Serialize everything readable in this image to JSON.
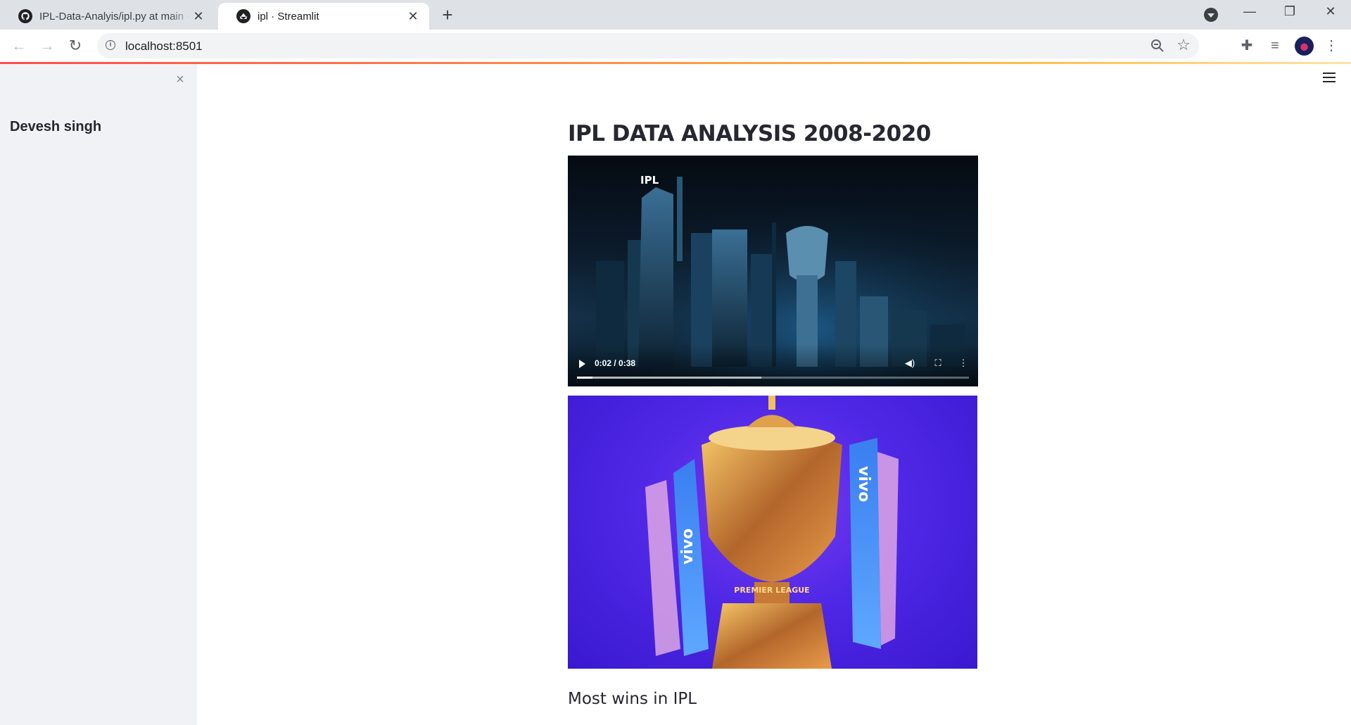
{
  "browser": {
    "tabs": [
      {
        "title": "IPL-Data-Analyis/ipl.py at main · ",
        "favicon": "github-icon",
        "active": false
      },
      {
        "title": "ipl · Streamlit",
        "favicon": "streamlit-icon",
        "active": true
      }
    ],
    "url": "localhost:8501"
  },
  "sidebar": {
    "title": "Devesh singh",
    "close_icon": "×"
  },
  "main": {
    "title": "IPL DATA ANALYSIS 2008-2020",
    "video": {
      "current_time": "0:02 / 0:38",
      "progress": 0.04,
      "buffered": 0.47,
      "logo_text": "IPL"
    },
    "image": {
      "ribbon_text": "vivo",
      "trophy_text": "PREMIER LEAGUE"
    },
    "subheading": "Most wins in IPL"
  },
  "colors": {
    "sidebar_bg": "#f0f2f6",
    "text": "#262730",
    "accent_start": "#ff4b4b",
    "accent_end": "#ffbd45"
  }
}
